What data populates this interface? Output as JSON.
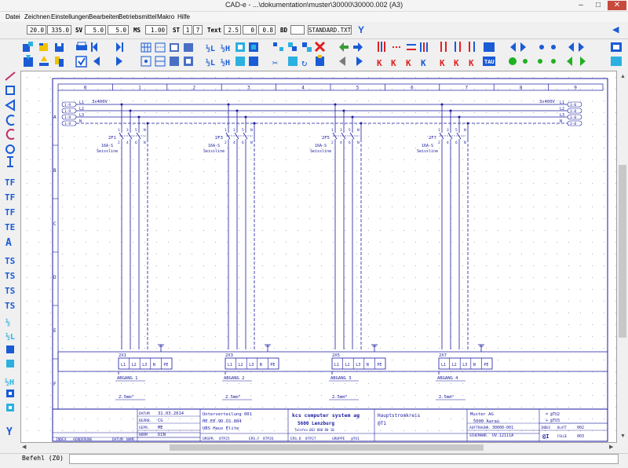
{
  "window": {
    "title": "CAD-e - ...\\dokumentation\\muster\\30000\\30000.002 (A3)"
  },
  "menu": [
    "Datei",
    "Zeichnen",
    "Einstellungen",
    "Bearbeiten",
    "Betriebsmittel",
    "Makro",
    "Hilfe"
  ],
  "fields": {
    "v1": "20.0",
    "v2": "335.0",
    "sv_label": "SV",
    "sv1": "5.0",
    "sv2": "5.0",
    "ms_label": "MS",
    "ms": "1.00",
    "st_label": "ST",
    "st1": "1",
    "st2": "7",
    "text_label": "Text",
    "t1": "2.5",
    "t2": "0",
    "t3": "0.8",
    "bd_label": "BD",
    "bd": "",
    "style": "STANDARD.TXT"
  },
  "status": {
    "command": "Befehl (Z0)"
  },
  "colors": {
    "line": "#1a1aa0",
    "accent": "#1a5bd6"
  },
  "drawing": {
    "columns": [
      "0",
      "1",
      "2",
      "3",
      "4",
      "5",
      "6",
      "7",
      "8",
      "9"
    ],
    "rows": [
      "A",
      "B",
      "C",
      "D",
      "E",
      "F"
    ],
    "left_conn": [
      "1-9",
      "1-9",
      "1-9",
      "1-9"
    ],
    "right_conn": [
      "3-0",
      "3-0",
      "3-0",
      "3-0"
    ],
    "phases": [
      "L1",
      "L2",
      "L3",
      "N"
    ],
    "supply_left": "3x400V",
    "supply_right": "3x400V",
    "breakers": [
      {
        "id": "2F1",
        "type": "16A-S",
        "maker": "Seissline"
      },
      {
        "id": "2F3",
        "type": "16A-S",
        "maker": "Seissline"
      },
      {
        "id": "2F5",
        "type": "16A-S",
        "maker": "Seissline"
      },
      {
        "id": "2F7",
        "type": "16A-S",
        "maker": "Seissline"
      }
    ],
    "term_top": [
      "1",
      "3",
      "5",
      "N"
    ],
    "term_bot": [
      "2",
      "4",
      "6",
      "N"
    ],
    "terminals": [
      {
        "id": "2X1",
        "label": "ABGANG 1",
        "cable": "2.5mm²"
      },
      {
        "id": "2X3",
        "label": "ABGANG 2",
        "cable": "2.5mm²"
      },
      {
        "id": "2X5",
        "label": "ABGANG 3",
        "cable": "2.5mm²"
      },
      {
        "id": "2X7",
        "label": "ABGANG 4",
        "cable": "2.5mm²"
      }
    ],
    "terminal_cells": [
      "L1",
      "L2",
      "L3",
      "N",
      "PE"
    ],
    "titleblock": {
      "datum_lbl": "DATUM",
      "datum": "31.03.2014",
      "bearb_lbl": "BEARB.",
      "bearb": "CG",
      "gepr_lbl": "GEPR.",
      "gepr": "ME",
      "norm_lbl": "NORM",
      "norm": "DIN",
      "sub1": "Unterverteilung 001",
      "sub2": "HE.EE.9D.U1.884",
      "sub3": "UBS Haus Elite",
      "ursp_lbl": "URSPR.",
      "ursp": "8TP25",
      "ers_f_lbl": "ERS.F",
      "ers_f": "8TP26",
      "ers_d_lbl": "ERS.D",
      "ers_d": "8TP27",
      "company": "kcs computer system ag",
      "city": "5600 Lenzburg",
      "phone": "Telefon 062 888 80 10",
      "gruppe_lbl": "GRUPPE",
      "gruppe": "@TU1",
      "circuit": "Hauptstromkreis",
      "circuit_ref": "@T1",
      "client": "Muster AG",
      "client_city": "5000 Aarau",
      "auftrag_lbl": "AUFTRAGNR.",
      "auftrag": "30000-001",
      "schema_lbl": "SCHEMANR.",
      "schema": "UV.12111A",
      "ref1": "= @TU2",
      "ref2": "+ @TU3",
      "index_lbl": "INDEX",
      "blatt_lbl": "BLATT",
      "blatt": "002",
      "folge_lbl": "FOLGE",
      "folge": "003",
      "at": "@I",
      "hist_index": "INDEX",
      "hist_aend": "AENDERUNG",
      "hist_datum": "DATUM",
      "hist_name": "NAME"
    }
  }
}
